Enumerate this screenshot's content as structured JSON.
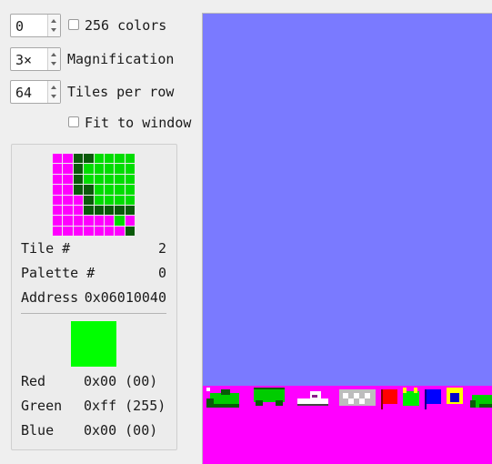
{
  "controls": {
    "palette_index": "0",
    "colors256_label": "256 colors",
    "magnification_value": "3×",
    "magnification_label": "Magnification",
    "tiles_per_row_value": "64",
    "tiles_per_row_label": "Tiles per row",
    "fit_label": "Fit to window"
  },
  "tile_info": {
    "tile_label": "Tile #",
    "tile_value": "2",
    "palette_label": "Palette #",
    "palette_value": "0",
    "address_label": "Address",
    "address_value": "0x06010040"
  },
  "color_info": {
    "swatch_color": "#00ff00",
    "red_label": "Red",
    "red_value": "0x00 (00)",
    "green_label": "Green",
    "green_value": "0xff (255)",
    "blue_label": "Blue",
    "blue_value": "0x00 (00)"
  },
  "tile_pixels": [
    "MMDDGGGG",
    "MMDGGGGG",
    "MMDGGGGG",
    "MMDDGGGG",
    "MMMDGGGG",
    "MMMDDDDD",
    "MMMMMMGM",
    "MMMMMMMD"
  ],
  "tile_colors": {
    "M": "#ff00ff",
    "D": "#0a5a0a",
    "G": "#00dd00"
  },
  "canvas": {
    "background": "#7a7aff",
    "transparent_color": "#ff00ff"
  }
}
